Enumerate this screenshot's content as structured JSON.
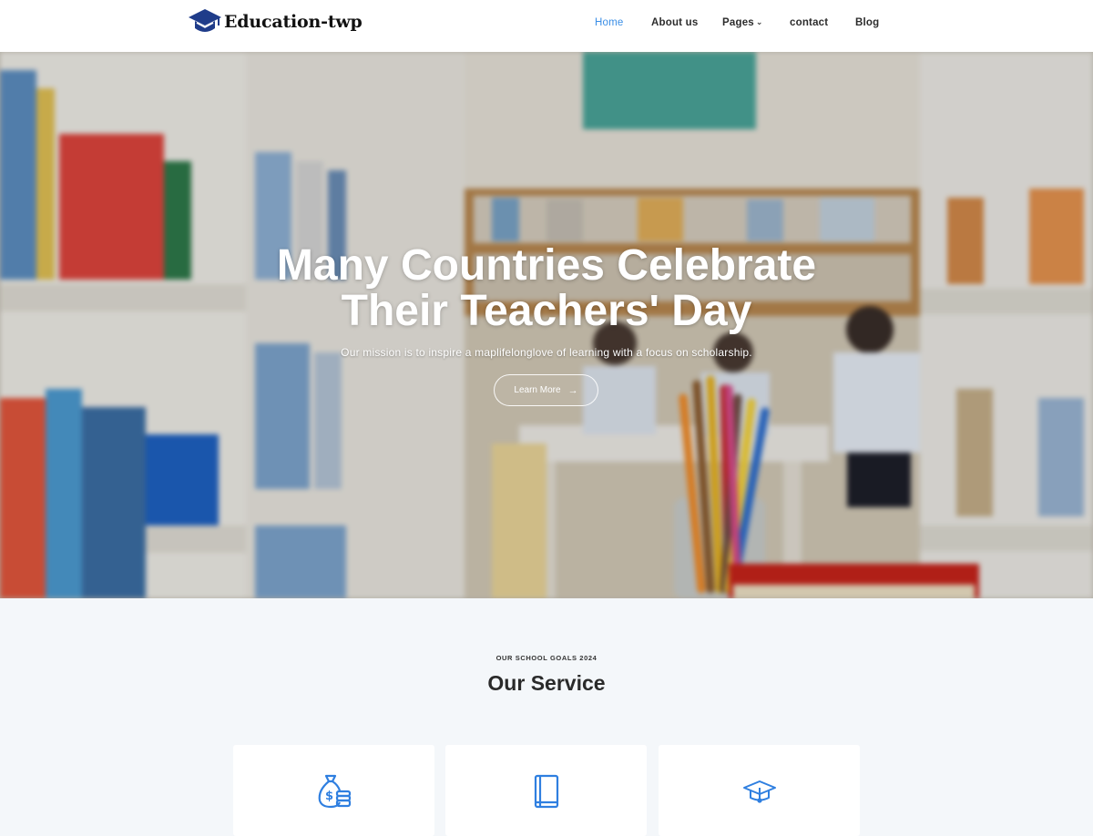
{
  "brand": {
    "name": "Education-twp",
    "accent": "#3a8ee6",
    "logo_color": "#1f3c8a"
  },
  "nav": {
    "items": [
      {
        "label": "Home",
        "active": true
      },
      {
        "label": "About us",
        "active": false
      },
      {
        "label": "Pages",
        "active": false,
        "has_dropdown": true
      },
      {
        "label": "contact",
        "active": false
      },
      {
        "label": "Blog",
        "active": false
      }
    ]
  },
  "hero": {
    "title_line1": "Many Countries Celebrate",
    "title_line2": "Their Teachers' Day",
    "subtitle": "Our mission is to inspire a maplifelonglove of learning with a focus on scholarship.",
    "button_label": "Learn More",
    "button_icon": "arrow-right-icon"
  },
  "services": {
    "eyebrow": "OUR SCHOOL GOALS 2024",
    "title": "Our Service",
    "cards": [
      {
        "icon": "money-bag-coins-icon"
      },
      {
        "icon": "book-icon"
      },
      {
        "icon": "graduation-cap-icon"
      }
    ]
  }
}
